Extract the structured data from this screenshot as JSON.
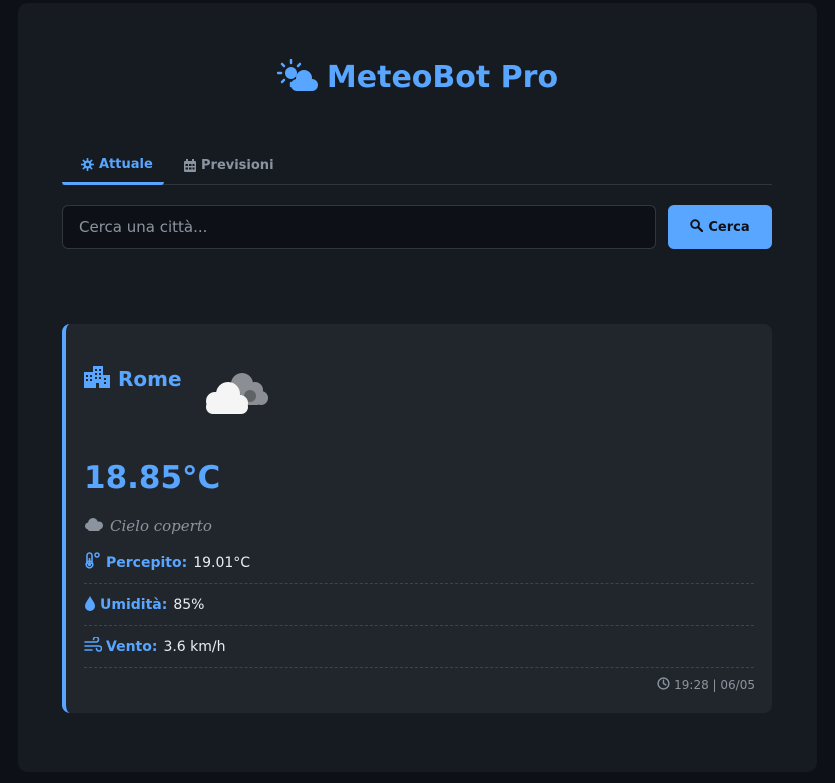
{
  "app": {
    "title": "MeteoBot Pro",
    "accent_color": "#58a6ff",
    "title_icon": "sun-cloud-icon"
  },
  "tabs": [
    {
      "label": "Attuale",
      "icon": "gear-icon",
      "active": true
    },
    {
      "label": "Previsioni",
      "icon": "calendar-icon",
      "active": false
    }
  ],
  "search": {
    "placeholder": "Cerca una città...",
    "value": "",
    "button_label": "Cerca",
    "button_icon": "search-icon"
  },
  "weather": {
    "city": "Rome",
    "city_icon": "city-icon",
    "condition_icon": "cloudy-icon",
    "temperature": "18.85°C",
    "description": "Cielo coperto",
    "details": [
      {
        "label": "Percepito:",
        "value": "19.01°C",
        "icon": "thermometer-icon"
      },
      {
        "label": "Umidità:",
        "value": "85%",
        "icon": "droplet-icon"
      },
      {
        "label": "Vento:",
        "value": "3.6 km/h",
        "icon": "wind-icon"
      }
    ],
    "timestamp": "19:28 | 06/05",
    "timestamp_icon": "clock-icon"
  }
}
